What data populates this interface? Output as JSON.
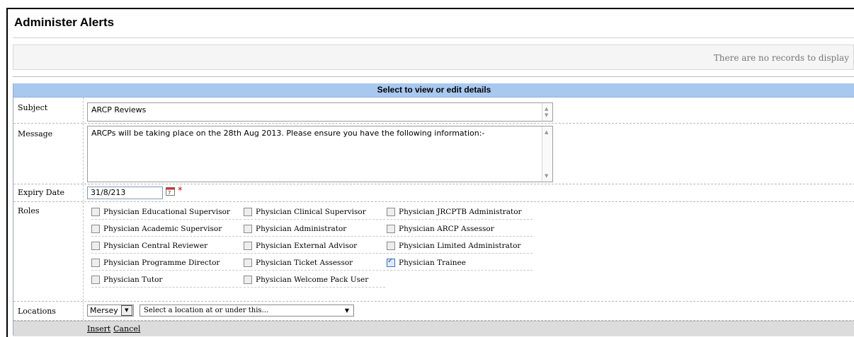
{
  "page": {
    "title": "Administer Alerts"
  },
  "grid": {
    "empty_message": "There are no records to display"
  },
  "form": {
    "header": "Select to view or edit details",
    "subject": {
      "label": "Subject",
      "value": "ARCP Reviews"
    },
    "message": {
      "label": "Message",
      "value": "ARCPs will be taking place on the 28th Aug 2013. Please ensure you have the following information:-"
    },
    "expiry": {
      "label": "Expiry Date",
      "value": "31/8/213",
      "required_marker": "*"
    },
    "roles": {
      "label": "Roles",
      "items": [
        {
          "label": "Physician Educational Supervisor",
          "checked": false
        },
        {
          "label": "Physician Clinical Supervisor",
          "checked": false
        },
        {
          "label": "Physician JRCPTB Administrator",
          "checked": false
        },
        {
          "label": "Physician Academic Supervisor",
          "checked": false
        },
        {
          "label": "Physician Administrator",
          "checked": false
        },
        {
          "label": "Physician ARCP Assessor",
          "checked": false
        },
        {
          "label": "Physician Central Reviewer",
          "checked": false
        },
        {
          "label": "Physician External Advisor",
          "checked": false
        },
        {
          "label": "Physician Limited Administrator",
          "checked": false
        },
        {
          "label": "Physician Programme Director",
          "checked": false
        },
        {
          "label": "Physician Ticket Assessor",
          "checked": false
        },
        {
          "label": "Physician Trainee",
          "checked": true
        },
        {
          "label": "Physician Tutor",
          "checked": false
        },
        {
          "label": "Physician Welcome Pack User",
          "checked": false
        }
      ]
    },
    "locations": {
      "label": "Locations",
      "region": "Mersey",
      "placeholder": "Select a location at or under this..."
    },
    "actions": {
      "insert": "Insert",
      "cancel": "Cancel"
    }
  },
  "colors": {
    "header_bg": "#a8c8f0",
    "required": "#d00000"
  }
}
